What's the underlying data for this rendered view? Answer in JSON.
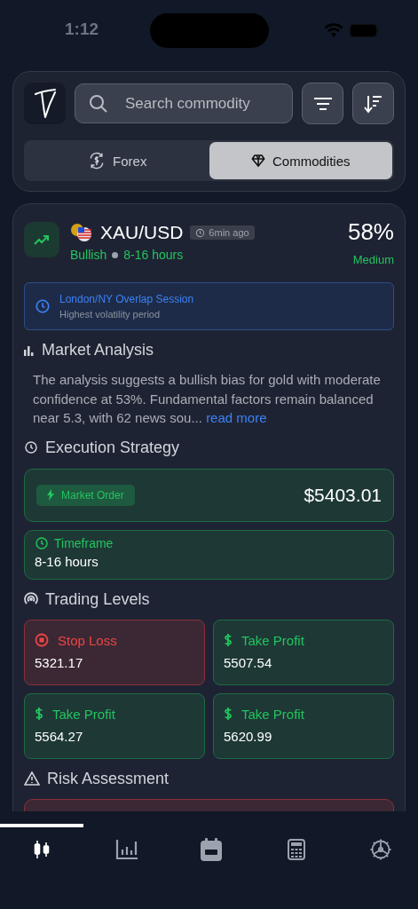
{
  "status_bar": {
    "time": "1:12"
  },
  "header": {
    "search": {
      "placeholder": "Search commodity"
    },
    "tabs": [
      {
        "label": "Forex",
        "selected": false
      },
      {
        "label": "Commodities",
        "selected": true
      }
    ]
  },
  "signal": {
    "symbol": "XAU/USD",
    "age": "6min ago",
    "direction": "Bullish",
    "duration": "8-16 hours",
    "confidence": "58%",
    "confidence_label": "Medium",
    "session": {
      "title": "London/NY Overlap Session",
      "subtitle": "Highest volatility period"
    },
    "analysis": {
      "heading": "Market Analysis",
      "text": "The analysis suggests a bullish bias for gold with moderate confidence at 53%. Fundamental factors remain balanced near 5.3, with 62 news sou...",
      "link": "read more"
    },
    "execution": {
      "heading": "Execution Strategy",
      "order_type": "Market Order",
      "price": "$5403.01",
      "timeframe_label": "Timeframe",
      "timeframe": "8-16 hours"
    },
    "levels": {
      "heading": "Trading Levels",
      "items": [
        {
          "kind": "stop",
          "label": "Stop Loss",
          "value": "5321.17"
        },
        {
          "kind": "target",
          "label": "Take Profit",
          "value": "5507.54"
        },
        {
          "kind": "target",
          "label": "Take Profit",
          "value": "5564.27"
        },
        {
          "kind": "target",
          "label": "Take Profit",
          "value": "5620.99"
        }
      ]
    },
    "risk": {
      "heading": "Risk Assessment"
    }
  },
  "nav": {
    "items": [
      {
        "selected": true
      },
      {
        "selected": false
      },
      {
        "selected": false
      },
      {
        "selected": false
      },
      {
        "selected": false
      }
    ]
  }
}
